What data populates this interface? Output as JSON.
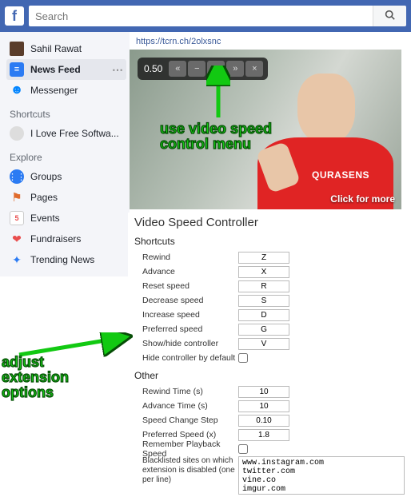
{
  "topbar": {
    "search_placeholder": "Search"
  },
  "sidebar": {
    "profile": "Sahil Rawat",
    "newsfeed": "News Feed",
    "messenger": "Messenger",
    "shortcuts_head": "Shortcuts",
    "shortcut1": "I Love Free Softwa...",
    "explore_head": "Explore",
    "groups": "Groups",
    "pages": "Pages",
    "events": "Events",
    "events_badge": "5",
    "fundraisers": "Fundraisers",
    "trending": "Trending News"
  },
  "post": {
    "url": "https://tcrn.ch/2olxsnc",
    "shirt": "QURASENS",
    "click_more": "Click for more"
  },
  "speed": {
    "value": "0.50",
    "rewind": "«",
    "minus": "−",
    "plus": "+",
    "advance": "»",
    "close": "×"
  },
  "annotations": {
    "use1": "use video speed",
    "use2": "control menu",
    "adj1": "adjust",
    "adj2": "extension",
    "adj3": "options"
  },
  "settings": {
    "title": "Video Speed Controller",
    "shortcuts_head": "Shortcuts",
    "other_head": "Other",
    "rows_shortcuts": [
      {
        "label": "Rewind",
        "val": "Z"
      },
      {
        "label": "Advance",
        "val": "X"
      },
      {
        "label": "Reset speed",
        "val": "R"
      },
      {
        "label": "Decrease speed",
        "val": "S"
      },
      {
        "label": "Increase speed",
        "val": "D"
      },
      {
        "label": "Preferred speed",
        "val": "G"
      },
      {
        "label": "Show/hide controller",
        "val": "V"
      }
    ],
    "hide_default_label": "Hide controller by default",
    "rows_other": [
      {
        "label": "Rewind Time (s)",
        "val": "10"
      },
      {
        "label": "Advance Time (s)",
        "val": "10"
      },
      {
        "label": "Speed Change Step",
        "val": "0.10"
      },
      {
        "label": "Preferred Speed (x)",
        "val": "1.8"
      }
    ],
    "remember_label": "Remember Playback Speed",
    "blacklist_label": "Blacklisted sites on which extension is disabled (one per line)",
    "blacklist_value": "www.instagram.com\ntwitter.com\nvine.co\nimgur.com"
  }
}
